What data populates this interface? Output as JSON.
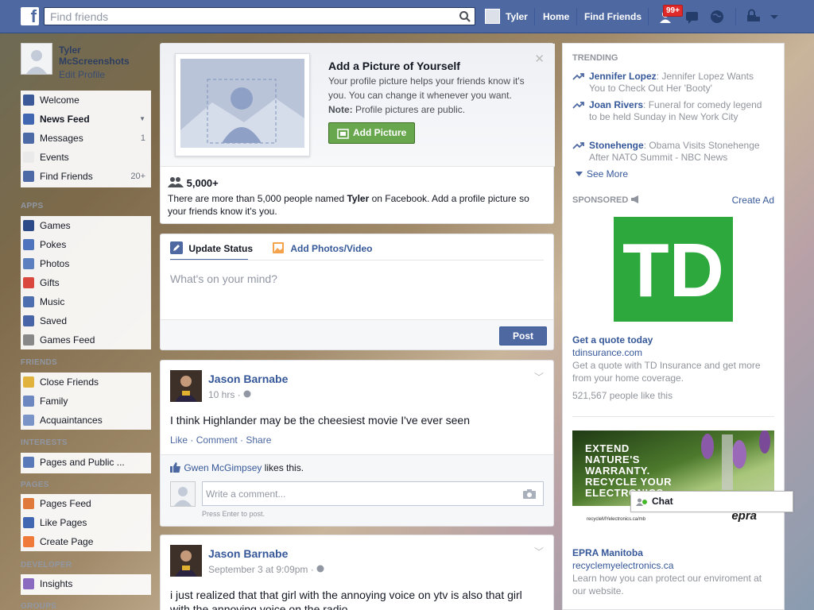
{
  "topbar": {
    "logo": "f",
    "search_placeholder": "Find friends",
    "user_name": "Tyler",
    "home": "Home",
    "find_friends": "Find Friends",
    "notif_count": "99+"
  },
  "leftnav": {
    "profile_name": "Tyler McScreenshots",
    "edit_profile": "Edit Profile",
    "main_items": [
      {
        "label": "Welcome",
        "count": "",
        "icon": "facebook-icon",
        "color": "#3b5998"
      },
      {
        "label": "News Feed",
        "count": "",
        "icon": "news-feed-icon",
        "color": "#4267b2"
      },
      {
        "label": "Messages",
        "count": "1",
        "icon": "messages-icon",
        "color": "#4c6aa6"
      },
      {
        "label": "Events",
        "count": "",
        "icon": "calendar-icon",
        "color": "#eaeaea"
      },
      {
        "label": "Find Friends",
        "count": "20+",
        "icon": "find-friends-icon",
        "color": "#4d6aa6"
      }
    ],
    "apps_header": "APPS",
    "apps": [
      {
        "label": "Games",
        "icon": "games-icon",
        "color": "#2c4a87"
      },
      {
        "label": "Pokes",
        "icon": "pokes-icon",
        "color": "#4f74bd"
      },
      {
        "label": "Photos",
        "icon": "photos-icon",
        "color": "#5b7fbf"
      },
      {
        "label": "Gifts",
        "icon": "gift-icon",
        "color": "#d9473d"
      },
      {
        "label": "Music",
        "icon": "music-icon",
        "color": "#4d6fb0"
      },
      {
        "label": "Saved",
        "icon": "saved-icon",
        "color": "#4866a7"
      },
      {
        "label": "Games Feed",
        "icon": "controller-icon",
        "color": "#888888"
      }
    ],
    "friends_header": "FRIENDS",
    "friends": [
      {
        "label": "Close Friends",
        "icon": "star-icon",
        "color": "#e2b33c"
      },
      {
        "label": "Family",
        "icon": "family-icon",
        "color": "#6d88c0"
      },
      {
        "label": "Acquaintances",
        "icon": "acquaintances-icon",
        "color": "#7a94c8"
      }
    ],
    "interests_header": "INTERESTS",
    "interests": [
      {
        "label": "Pages and Public ...",
        "icon": "rss-icon",
        "color": "#5a79b8"
      }
    ],
    "pages_header": "PAGES",
    "pages": [
      {
        "label": "Pages Feed",
        "icon": "megaphone-icon",
        "color": "#e07a3a"
      },
      {
        "label": "Like Pages",
        "icon": "like-icon",
        "color": "#4267b2"
      },
      {
        "label": "Create Page",
        "icon": "plus-icon",
        "color": "#f07a3a"
      }
    ],
    "developer_header": "DEVELOPER",
    "developer": [
      {
        "label": "Insights",
        "icon": "insights-icon",
        "color": "#8a6bbf"
      }
    ],
    "groups_header": "GROUPS"
  },
  "profile_prompt": {
    "title": "Add a Picture of Yourself",
    "desc": "Your profile picture helps your friends know it's you. You can change it whenever you want.",
    "note_label": "Note:",
    "note_text": " Profile pictures are public.",
    "button": "Add Picture",
    "count": "5,000+",
    "count_desc_pre": "There are more than 5,000 people named ",
    "count_name": "Tyler",
    "count_desc_post": " on Facebook. Add a profile picture so your friends know it's you."
  },
  "status": {
    "tab_update": "Update Status",
    "tab_photos": "Add Photos/Video",
    "placeholder": "What's on your mind?",
    "post": "Post"
  },
  "posts": [
    {
      "author": "Jason Barnabe",
      "time": "10 hrs",
      "text": "I think Highlander may be the cheesiest movie I've ever seen",
      "like": "Like",
      "comment": "Comment",
      "share": "Share",
      "liker": "Gwen McGimpsey",
      "likes_suffix": " likes this.",
      "comment_placeholder": "Write a comment...",
      "hint": "Press Enter to post."
    },
    {
      "author": "Jason Barnabe",
      "time": "September 3 at 9:09pm",
      "text": "i just realized that that girl with the annoying voice on ytv is also that girl with the annoying voice on the radio"
    }
  ],
  "trending": {
    "header": "TRENDING",
    "items": [
      {
        "name": "Jennifer Lopez",
        "text": ": Jennifer Lopez Wants You to Check Out Her 'Booty'"
      },
      {
        "name": "Joan Rivers",
        "text": ": Funeral for comedy legend to be held Sunday in New York City"
      },
      {
        "name": "Stonehenge",
        "text": ": Obama Visits Stonehenge After NATO Summit - NBC News"
      }
    ],
    "see_more": "See More"
  },
  "sponsored": {
    "header": "SPONSORED",
    "create_ad": "Create Ad",
    "ads": [
      {
        "logo": "TD",
        "title": "Get a quote today",
        "url": "tdinsurance.com",
        "desc": "Get a quote with TD Insurance and get more from your home coverage.",
        "likes": "521,567 people like this"
      },
      {
        "image_text": "EXTEND NATURE'S WARRANTY. RECYCLE YOUR ELECTRONICS",
        "image_small": "recycleMYelectronics.ca/mb",
        "image_logo": "epra",
        "title": "EPRA Manitoba",
        "url": "recyclemyelectronics.ca",
        "desc": "Learn how you can protect our enviroment at our website."
      }
    ]
  },
  "chat": {
    "label": "Chat"
  }
}
